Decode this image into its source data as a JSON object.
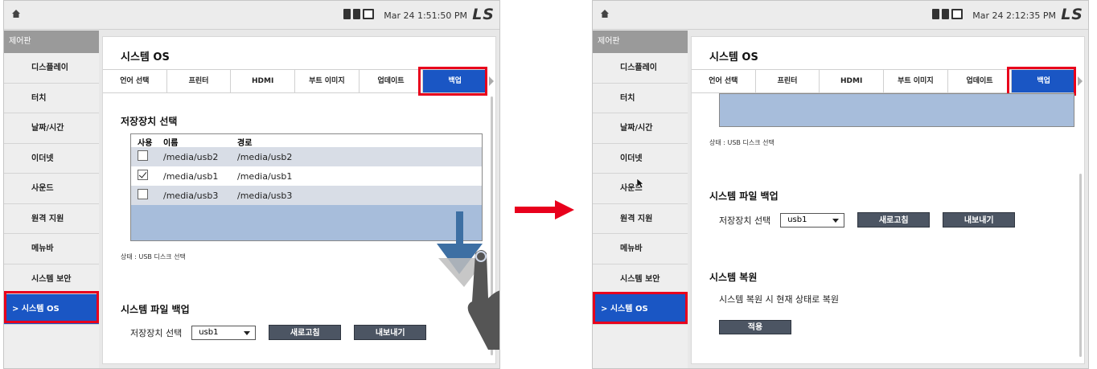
{
  "screens": [
    {
      "clock": "Mar 24 1:51:50 PM",
      "logo": "LS",
      "sidebar": {
        "title": "제어판",
        "items": [
          "디스플레이",
          "터치",
          "날짜/시간",
          "이더넷",
          "사운드",
          "원격 지원",
          "메뉴바",
          "시스템 보안",
          "> 시스템 OS"
        ]
      },
      "panel_title": "시스템 OS",
      "tabs": [
        "언어 선택",
        "프린터",
        "HDMI",
        "부트 이미지",
        "업데이트",
        "백업"
      ],
      "storage_section": "저장장치 선택",
      "storage_headers": [
        "사용",
        "이름",
        "경로"
      ],
      "storage_rows": [
        {
          "checked": false,
          "name": "/media/usb2",
          "path": "/media/usb2"
        },
        {
          "checked": true,
          "name": "/media/usb1",
          "path": "/media/usb1"
        },
        {
          "checked": false,
          "name": "/media/usb3",
          "path": "/media/usb3"
        }
      ],
      "status": "상태 : USB 디스크 선택",
      "backup_section": "시스템 파일 백업",
      "storage_label": "저장장치 선택",
      "select_value": "usb1",
      "refresh_label": "새로고침",
      "export_label": "내보내기"
    },
    {
      "clock": "Mar 24 2:12:35 PM",
      "logo": "LS",
      "sidebar": {
        "title": "제어판",
        "items": [
          "디스플레이",
          "터치",
          "날짜/시간",
          "이더넷",
          "사운드",
          "원격 지원",
          "메뉴바",
          "시스템 보안",
          "> 시스템 OS"
        ]
      },
      "panel_title": "시스템 OS",
      "tabs": [
        "언어 선택",
        "프린터",
        "HDMI",
        "부트 이미지",
        "업데이트",
        "백업"
      ],
      "status": "상태 : USB 디스크 선택",
      "backup_section": "시스템 파일 백업",
      "storage_label": "저장장치 선택",
      "select_value": "usb1",
      "refresh_label": "새로고침",
      "export_label": "내보내기",
      "restore_section": "시스템 복원",
      "restore_text": "시스템 복원 시 현재 상태로 복원",
      "apply_label": "적용"
    }
  ],
  "colors": {
    "accent": "#1a56c4",
    "highlight": "#e8001c",
    "list_fill": "#a7bddb",
    "button": "#4c5563"
  },
  "icons": [
    "home-icon",
    "sd-card-icon",
    "usb-icon",
    "monitor-icon",
    "swipe-down-hand-icon",
    "right-arrow-icon",
    "mouse-cursor-icon"
  ]
}
